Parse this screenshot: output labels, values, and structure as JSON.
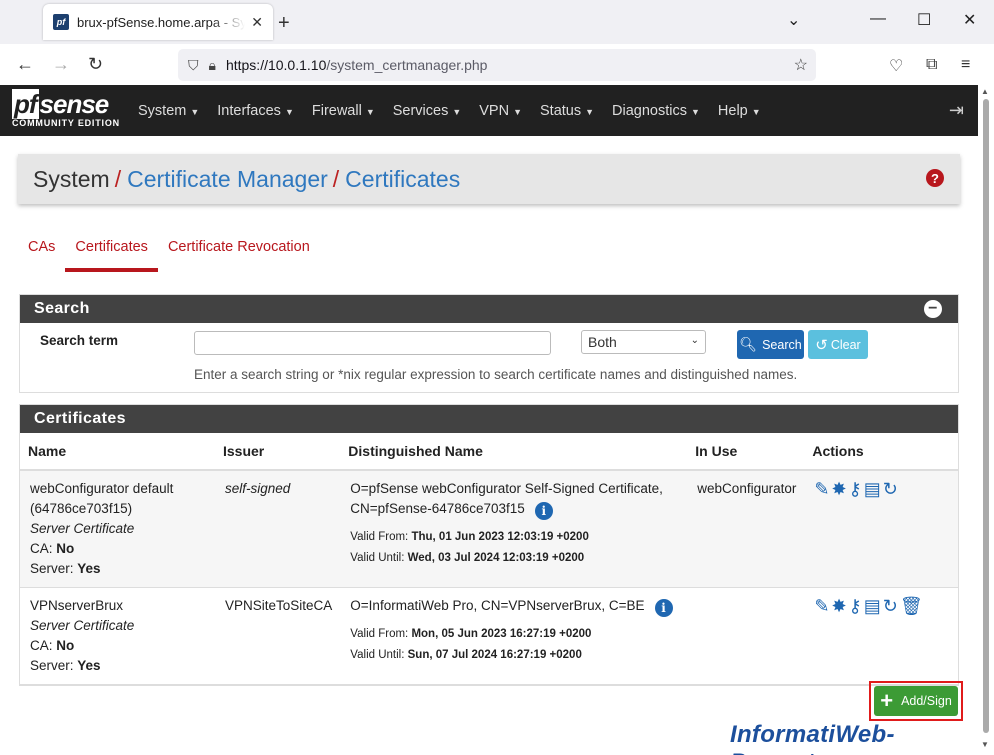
{
  "browser": {
    "tab_title": "brux-pfSense.home.arpa - System: Certificate Manager",
    "favicon": "pf",
    "url_host": "https://10.0.1.10",
    "url_path": "/system_certmanager.php"
  },
  "navbar": {
    "logo_main": "sense",
    "logo_pf": "pf",
    "logo_sub": "COMMUNITY EDITION",
    "menu": [
      "System",
      "Interfaces",
      "Firewall",
      "Services",
      "VPN",
      "Status",
      "Diagnostics",
      "Help"
    ]
  },
  "breadcrumb": {
    "root": "System",
    "sep": "/",
    "level1": "Certificate Manager",
    "level2": "Certificates"
  },
  "tabs": [
    "CAs",
    "Certificates",
    "Certificate Revocation"
  ],
  "search": {
    "panel_title": "Search",
    "term_label": "Search term",
    "term_value": "",
    "scope_selected": "Both",
    "search_button": "Search",
    "clear_button": "Clear",
    "help_text": "Enter a search string or *nix regular expression to search certificate names and distinguished names."
  },
  "certificates": {
    "panel_title": "Certificates",
    "columns": [
      "Name",
      "Issuer",
      "Distinguished Name",
      "In Use",
      "Actions"
    ],
    "rows": [
      {
        "name": "webConfigurator default (64786ce703f15)",
        "type": "Server Certificate",
        "ca_label": "CA:",
        "ca_value": "No",
        "server_label": "Server:",
        "server_value": "Yes",
        "issuer": "self-signed",
        "dn": "O=pfSense webConfigurator Self-Signed Certificate, CN=pfSense-64786ce703f15",
        "valid_from_label": "Valid From:",
        "valid_from": "Thu, 01 Jun 2023 12:03:19 +0200",
        "valid_until_label": "Valid Until:",
        "valid_until": "Wed, 03 Jul 2024 12:03:19 +0200",
        "in_use": "webConfigurator"
      },
      {
        "name": "VPNserverBrux",
        "type": "Server Certificate",
        "ca_label": "CA:",
        "ca_value": "No",
        "server_label": "Server:",
        "server_value": "Yes",
        "issuer": "VPNSiteToSiteCA",
        "dn": "O=InformatiWeb Pro, CN=VPNserverBrux, C=BE",
        "valid_from_label": "Valid From:",
        "valid_from": "Mon, 05 Jun 2023 16:27:19 +0200",
        "valid_until_label": "Valid Until:",
        "valid_until": "Sun, 07 Jul 2024 16:27:19 +0200",
        "in_use": ""
      }
    ],
    "add_button": "Add/Sign"
  },
  "watermark": "InformatiWeb-Pro.net",
  "colors": {
    "brand_red": "#b8171d",
    "link_blue": "#2f78bf",
    "panel_header": "#424242",
    "primary_blue": "#1f67b1",
    "success_green": "#3c9b35",
    "info_cyan": "#5bc0de"
  }
}
